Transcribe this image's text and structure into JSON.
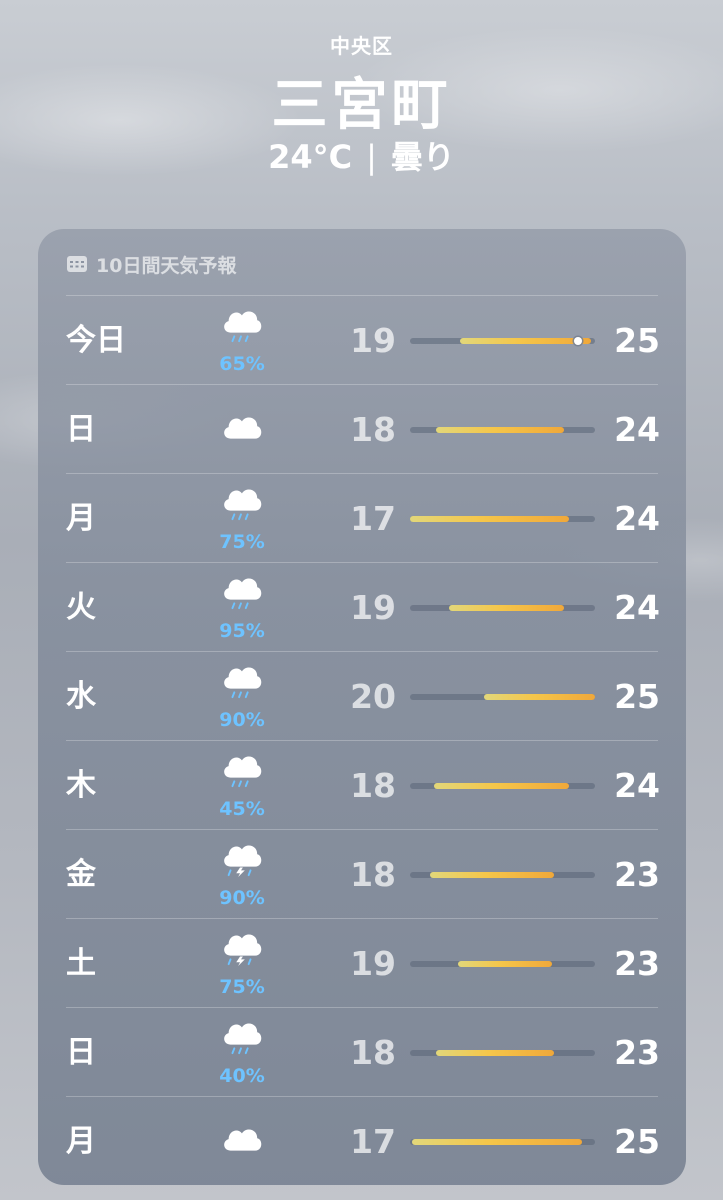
{
  "location": {
    "district": "中央区",
    "city": "三宮町",
    "current_temp": "24°C",
    "condition": "曇り"
  },
  "forecast": {
    "title": "10日間天気予報",
    "days": [
      {
        "day": "今日",
        "icon": "cloud-rain-icon",
        "precip": "65%",
        "low": "19",
        "high": "25",
        "range": [
          0.27,
          0.98
        ],
        "current_marker": 0.91
      },
      {
        "day": "日",
        "icon": "cloud-icon",
        "precip": "",
        "low": "18",
        "high": "24",
        "range": [
          0.14,
          0.83
        ]
      },
      {
        "day": "月",
        "icon": "cloud-rain-icon",
        "precip": "75%",
        "low": "17",
        "high": "24",
        "range": [
          0.0,
          0.86
        ]
      },
      {
        "day": "火",
        "icon": "cloud-rain-icon",
        "precip": "95%",
        "low": "19",
        "high": "24",
        "range": [
          0.21,
          0.83
        ]
      },
      {
        "day": "水",
        "icon": "cloud-rain-icon",
        "precip": "90%",
        "low": "20",
        "high": "25",
        "range": [
          0.4,
          1.0
        ]
      },
      {
        "day": "木",
        "icon": "cloud-rain-icon",
        "precip": "45%",
        "low": "18",
        "high": "24",
        "range": [
          0.13,
          0.86
        ]
      },
      {
        "day": "金",
        "icon": "cloud-bolt-rain-icon",
        "precip": "90%",
        "low": "18",
        "high": "23",
        "range": [
          0.11,
          0.78
        ]
      },
      {
        "day": "土",
        "icon": "cloud-bolt-rain-icon",
        "precip": "75%",
        "low": "19",
        "high": "23",
        "range": [
          0.26,
          0.77
        ]
      },
      {
        "day": "日",
        "icon": "cloud-rain-icon",
        "precip": "40%",
        "low": "18",
        "high": "23",
        "range": [
          0.14,
          0.78
        ]
      },
      {
        "day": "月",
        "icon": "cloud-icon",
        "precip": "",
        "low": "17",
        "high": "25",
        "range": [
          0.01,
          0.93
        ]
      }
    ]
  },
  "colors": {
    "precip_text": "#6ec3ff",
    "bar_start": "#e2d77a",
    "bar_end": "#f0a83a"
  }
}
